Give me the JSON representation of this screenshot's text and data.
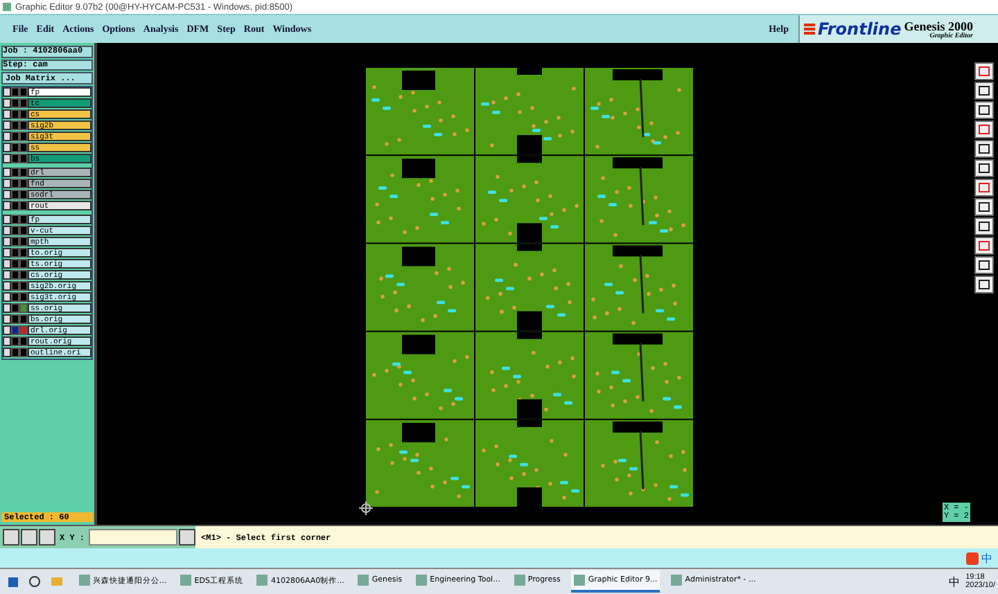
{
  "window": {
    "title": "Graphic Editor 9.07b2 (00@HY-HYCAM-PC531 - Windows, pid:8500)"
  },
  "menu": [
    "File",
    "Edit",
    "Actions",
    "Options",
    "Analysis",
    "DFM",
    "Step",
    "Rout",
    "Windows"
  ],
  "help": "Help",
  "logo": {
    "brand": "Frontline",
    "product": "Genesis 2000",
    "subtitle": "Graphic Editor"
  },
  "job": {
    "job": "Job : 4102806aa0",
    "step": "Step: cam",
    "matrix": "Job Matrix ..."
  },
  "layer_groups": [
    [
      {
        "name": "fp",
        "color": "#ffffff",
        "work": false,
        "affected": false
      },
      {
        "name": "tc",
        "color": "#139c78",
        "work": false,
        "affected": false
      },
      {
        "name": "cs",
        "color": "#f2c244",
        "work": false,
        "affected": false
      },
      {
        "name": "sig2b",
        "color": "#f2c244",
        "work": false,
        "affected": false
      },
      {
        "name": "sig3t",
        "color": "#f2c244",
        "work": false,
        "affected": false
      },
      {
        "name": "ss",
        "color": "#f2c244",
        "work": false,
        "affected": false
      },
      {
        "name": "bs",
        "color": "#139c78",
        "work": false,
        "affected": false
      }
    ],
    [
      {
        "name": "drl",
        "color": "#a9b4b8",
        "work": false,
        "affected": false
      },
      {
        "name": "fnd",
        "color": "#a9b4b8",
        "work": false,
        "affected": false
      },
      {
        "name": "sodrl",
        "color": "#a9b4b8",
        "work": false,
        "affected": false
      },
      {
        "name": "rout",
        "color": "#e6e6e6",
        "work": false,
        "affected": false
      }
    ],
    [
      {
        "name": "fp",
        "color": "#bfe9ef",
        "work": false,
        "affected": false
      },
      {
        "name": "v-cut",
        "color": "#bfe9ef",
        "work": false,
        "affected": false
      },
      {
        "name": "mpth",
        "color": "#bfe9ef",
        "work": false,
        "affected": false
      },
      {
        "name": "to.orig",
        "color": "#bfe9ef",
        "work": false,
        "affected": false
      },
      {
        "name": "ts.orig",
        "color": "#bfe9ef",
        "work": false,
        "affected": false
      },
      {
        "name": "cs.orig",
        "color": "#bfe9ef",
        "work": false,
        "affected": false
      },
      {
        "name": "sig2b.orig",
        "color": "#bfe9ef",
        "work": false,
        "affected": false
      },
      {
        "name": "sig3t.orig",
        "color": "#bfe9ef",
        "work": false,
        "affected": false
      },
      {
        "name": "ss.orig",
        "color": "#bfe9ef",
        "work": false,
        "affected": true
      },
      {
        "name": "bs.orig",
        "color": "#bfe9ef",
        "work": false,
        "affected": false
      },
      {
        "name": "drl.orig",
        "color": "#bfe9ef",
        "work": true,
        "affected": true
      },
      {
        "name": "rout.orig",
        "color": "#bfe9ef",
        "work": false,
        "affected": false
      },
      {
        "name": "outline.ori",
        "color": "#bfe9ef",
        "work": false,
        "affected": false
      }
    ]
  ],
  "selected": "Selected : 60",
  "coords": {
    "x": "X = -",
    "y": "Y = 2"
  },
  "command": {
    "xy_label": "X Y :",
    "prompt": "<M1> - Select first corner"
  },
  "taskbar": {
    "items": [
      {
        "label": "兴森快捷通阳分公...",
        "selected": false
      },
      {
        "label": "EDS工程系统",
        "selected": false
      },
      {
        "label": "4102806AA0制作...",
        "selected": false
      },
      {
        "label": "Genesis",
        "selected": false
      },
      {
        "label": "Engineering Tool...",
        "selected": false
      },
      {
        "label": "Progress",
        "selected": false
      },
      {
        "label": "Graphic Editor 9...",
        "selected": true
      },
      {
        "label": "Administrator* - ...",
        "selected": false
      }
    ],
    "ime": "中",
    "tray_ime": "中",
    "time": "19:18",
    "date": "2023/10/"
  }
}
